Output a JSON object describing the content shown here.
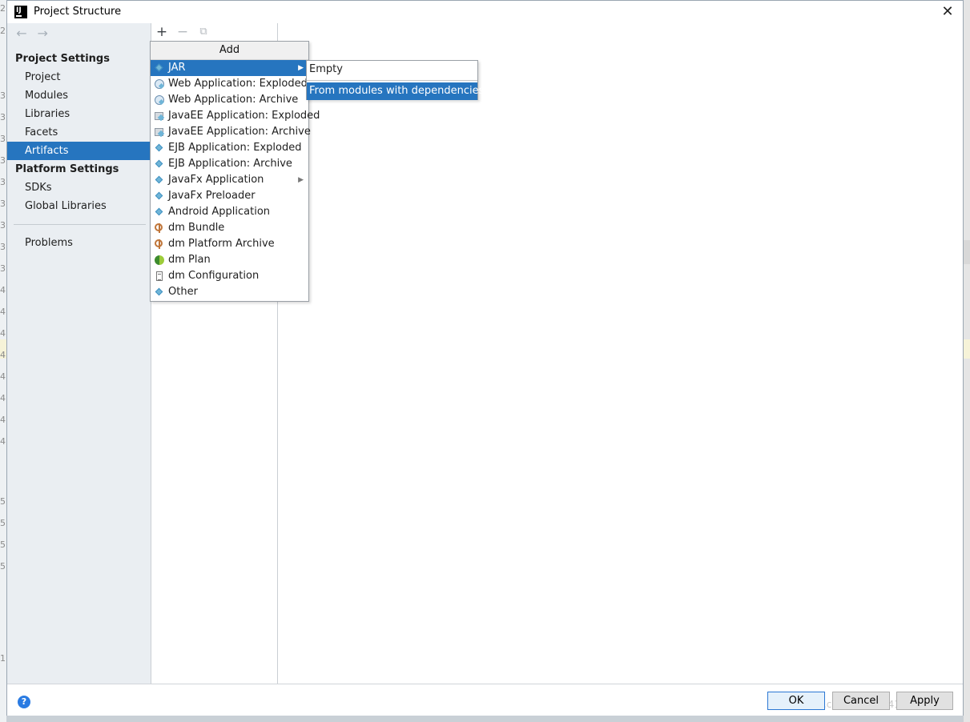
{
  "window": {
    "title": "Project Structure",
    "app_icon_label": "IJ",
    "close_glyph": "✕"
  },
  "navigation": {
    "back_glyph": "←",
    "forward_glyph": "→"
  },
  "sidebar": {
    "project_settings_header": "Project Settings",
    "platform_settings_header": "Platform Settings",
    "items": [
      {
        "label": "Project"
      },
      {
        "label": "Modules"
      },
      {
        "label": "Libraries"
      },
      {
        "label": "Facets"
      },
      {
        "label": "Artifacts",
        "selected": true
      },
      {
        "label": "SDKs"
      },
      {
        "label": "Global Libraries"
      },
      {
        "label": "Problems"
      }
    ]
  },
  "toolbar": {
    "add_glyph": "+",
    "remove_glyph": "−",
    "copy_glyph": "⧉"
  },
  "add_menu": {
    "header": "Add",
    "items": [
      {
        "label": "JAR",
        "icon": "diamond-icon",
        "selected": true,
        "submenu": true
      },
      {
        "label": "Web Application: Exploded",
        "icon": "web-app-icon"
      },
      {
        "label": "Web Application: Archive",
        "icon": "web-app-icon"
      },
      {
        "label": "JavaEE Application: Exploded",
        "icon": "javaee-icon"
      },
      {
        "label": "JavaEE Application: Archive",
        "icon": "javaee-icon"
      },
      {
        "label": "EJB Application: Exploded",
        "icon": "diamond-icon"
      },
      {
        "label": "EJB Application: Archive",
        "icon": "diamond-icon"
      },
      {
        "label": "JavaFx Application",
        "icon": "diamond-icon",
        "submenu": true
      },
      {
        "label": "JavaFx Preloader",
        "icon": "diamond-icon"
      },
      {
        "label": "Android Application",
        "icon": "diamond-icon"
      },
      {
        "label": "dm Bundle",
        "icon": "bundle-icon"
      },
      {
        "label": "dm Platform Archive",
        "icon": "bundle-icon"
      },
      {
        "label": "dm Plan",
        "icon": "plan-icon"
      },
      {
        "label": "dm Configuration",
        "icon": "config-icon"
      },
      {
        "label": "Other",
        "icon": "diamond-icon"
      }
    ]
  },
  "jar_submenu": {
    "items": [
      {
        "label": "Empty"
      },
      {
        "label": "From modules with dependencies...",
        "selected": true
      }
    ]
  },
  "buttons": {
    "help_glyph": "?",
    "ok": "OK",
    "cancel": "Cancel",
    "apply": "Apply"
  },
  "watermark": "https://blog.csdn.net/qq_41594978",
  "background_line_fragments": [
    "2",
    "2",
    "3",
    "3",
    "3",
    "3",
    "3",
    "3",
    "3",
    "3",
    "3",
    "4",
    "4",
    "4",
    "4",
    "4",
    "4",
    "4",
    "4",
    "5",
    "5",
    "5",
    "5",
    "1"
  ],
  "colors": {
    "selection": "#2675bf",
    "sidebar_bg": "#eaeef2",
    "help_icon": "#2a7be2"
  }
}
